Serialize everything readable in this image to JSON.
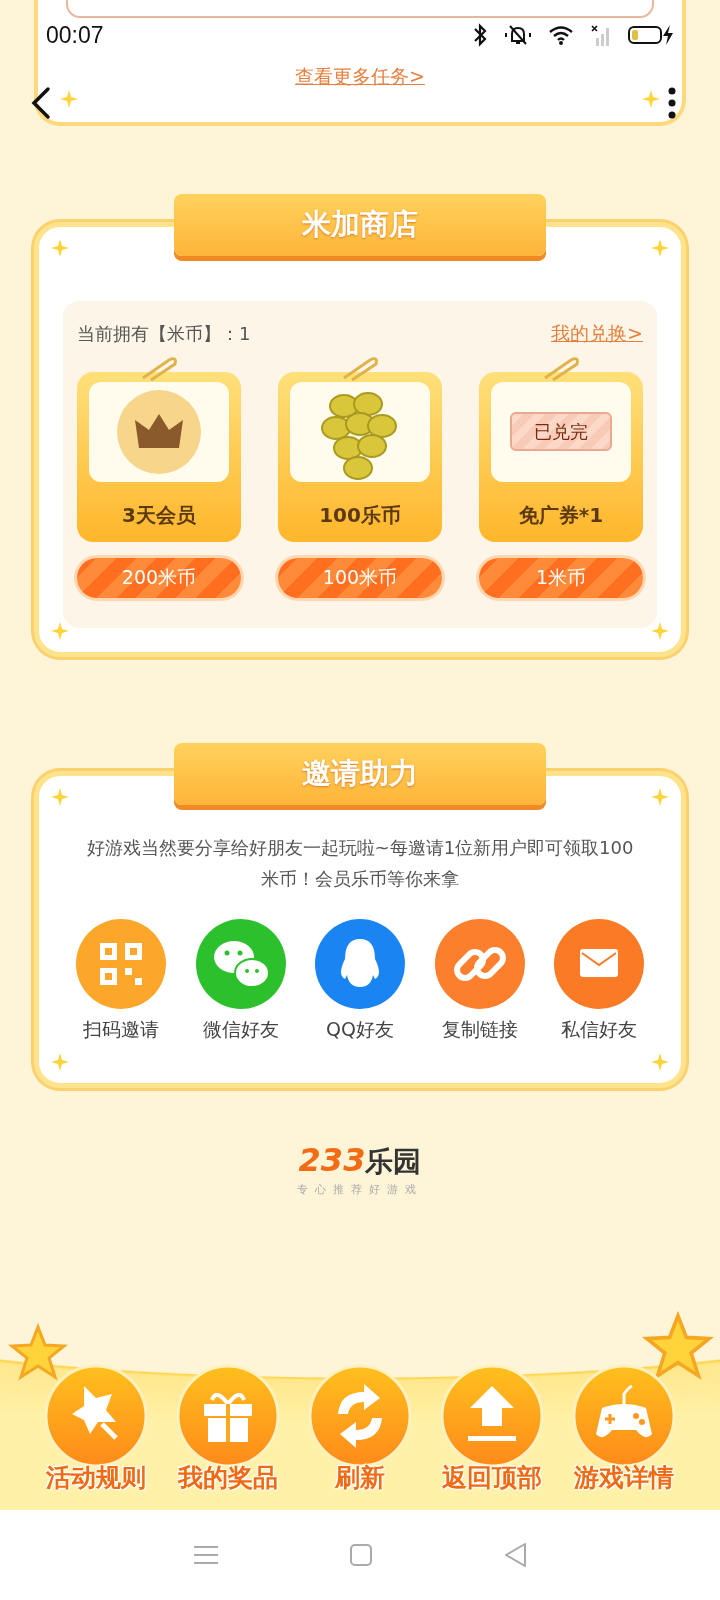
{
  "status_bar": {
    "time": "00:07"
  },
  "task_card": {
    "more_link": "查看更多任务>"
  },
  "shop": {
    "title": "米加商店",
    "balance": "当前拥有【米币】：1",
    "exchange_link": "我的兑换>",
    "items": [
      {
        "name": "3天会员",
        "price": "200米币",
        "kind": "vip"
      },
      {
        "name": "100乐币",
        "price": "100米币",
        "kind": "coins"
      },
      {
        "name": "免广券*1",
        "price": "1米币",
        "kind": "ticket",
        "stamp": "已兑完"
      }
    ]
  },
  "invite": {
    "title": "邀请助力",
    "description": "好游戏当然要分享给好朋友一起玩啦~每邀请1位新用户即可领取100米币！会员乐币等你来拿",
    "share_options": [
      {
        "label": "扫码邀请",
        "kind": "qr"
      },
      {
        "label": "微信好友",
        "kind": "wechat"
      },
      {
        "label": "QQ好友",
        "kind": "qq"
      },
      {
        "label": "复制链接",
        "kind": "link"
      },
      {
        "label": "私信好友",
        "kind": "message"
      }
    ]
  },
  "footer": {
    "logo_number": "233",
    "logo_name": "乐园",
    "slogan": "专心推荐好游戏"
  },
  "bottom_actions": [
    {
      "label": "活动规则",
      "kind": "rules"
    },
    {
      "label": "我的奖品",
      "kind": "prizes"
    },
    {
      "label": "刷新",
      "kind": "refresh"
    },
    {
      "label": "返回顶部",
      "kind": "top"
    },
    {
      "label": "游戏详情",
      "kind": "game"
    }
  ]
}
